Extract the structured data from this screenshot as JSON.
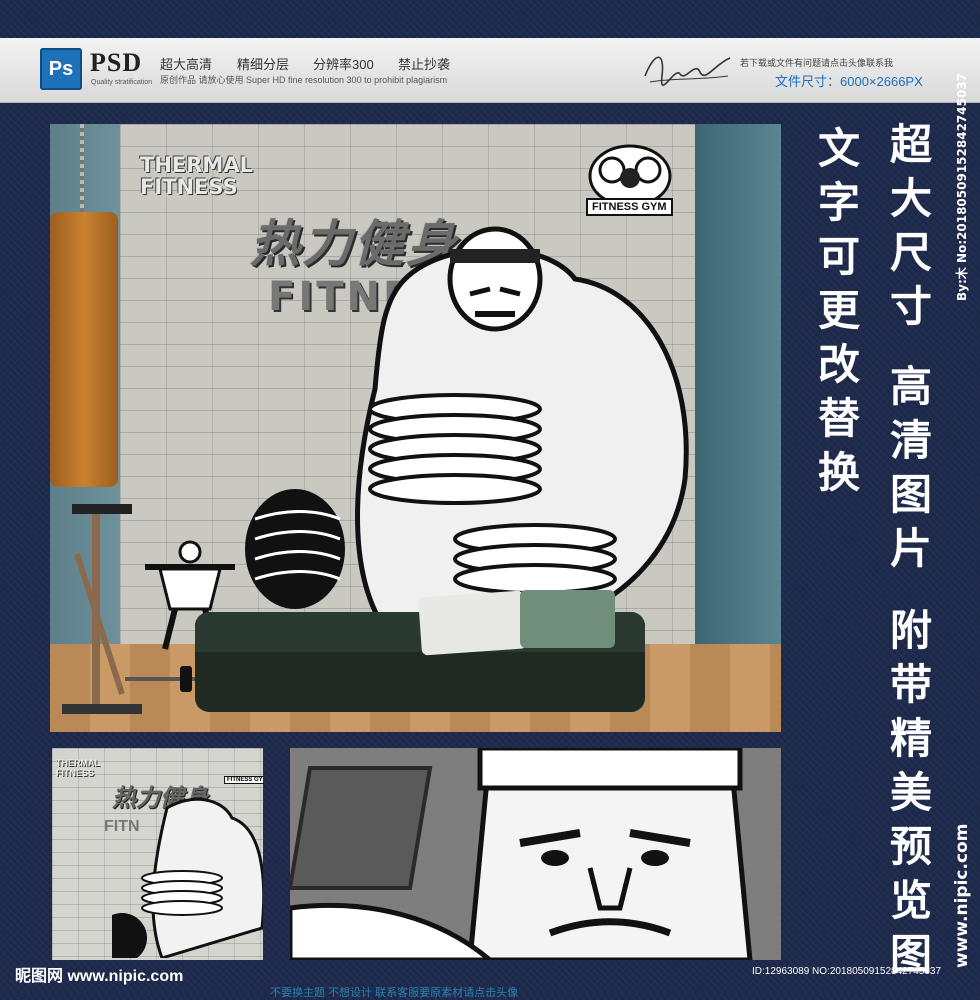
{
  "banner": {
    "ps_label": "Ps",
    "psd_label": "PSD",
    "psd_sub": "Quality stratification",
    "features": [
      "超大高清",
      "精细分层",
      "分辨率300",
      "禁止抄袭"
    ],
    "features_sub": "原创作品  请放心使用    Super HD  fine resolution 300  to prohibit  plagiarism",
    "notice": "若下载或文件有问题请点击头像联系我",
    "file_size": "文件尺寸：6000×2666PX"
  },
  "poster": {
    "title_en_line1": "THERMAL",
    "title_en_line2": "FITNESS",
    "title_cn": "热力健身",
    "title_fitness": "FITNE",
    "gym_logo_text": "FITNESS GYM"
  },
  "thumb1": {
    "title_en_line1": "THERMAL",
    "title_en_line2": "FITNESS",
    "title_cn": "热力健身",
    "title_fitness": "FITN",
    "gym_logo_text": "FITNESS GYM"
  },
  "side_text": {
    "col1": "文字可更改替换",
    "col2": "超大尺寸",
    "col3": "高清图片",
    "col4": "附带精美预览图"
  },
  "watermark": {
    "side_id": "By:木 No:20180509152842745037",
    "side_url": "www.nipic.com",
    "footer_logo": "昵图网 www.nipic.com",
    "footer_id": "ID:12963089 NO:20180509152842745037",
    "footer_strip": "不要换主题  不想设计  联系客服要原素材请点击头像"
  },
  "colors": {
    "background": "#1e2a4d",
    "ps_blue": "#1d71b8",
    "file_size_blue": "#1a6fbf"
  }
}
